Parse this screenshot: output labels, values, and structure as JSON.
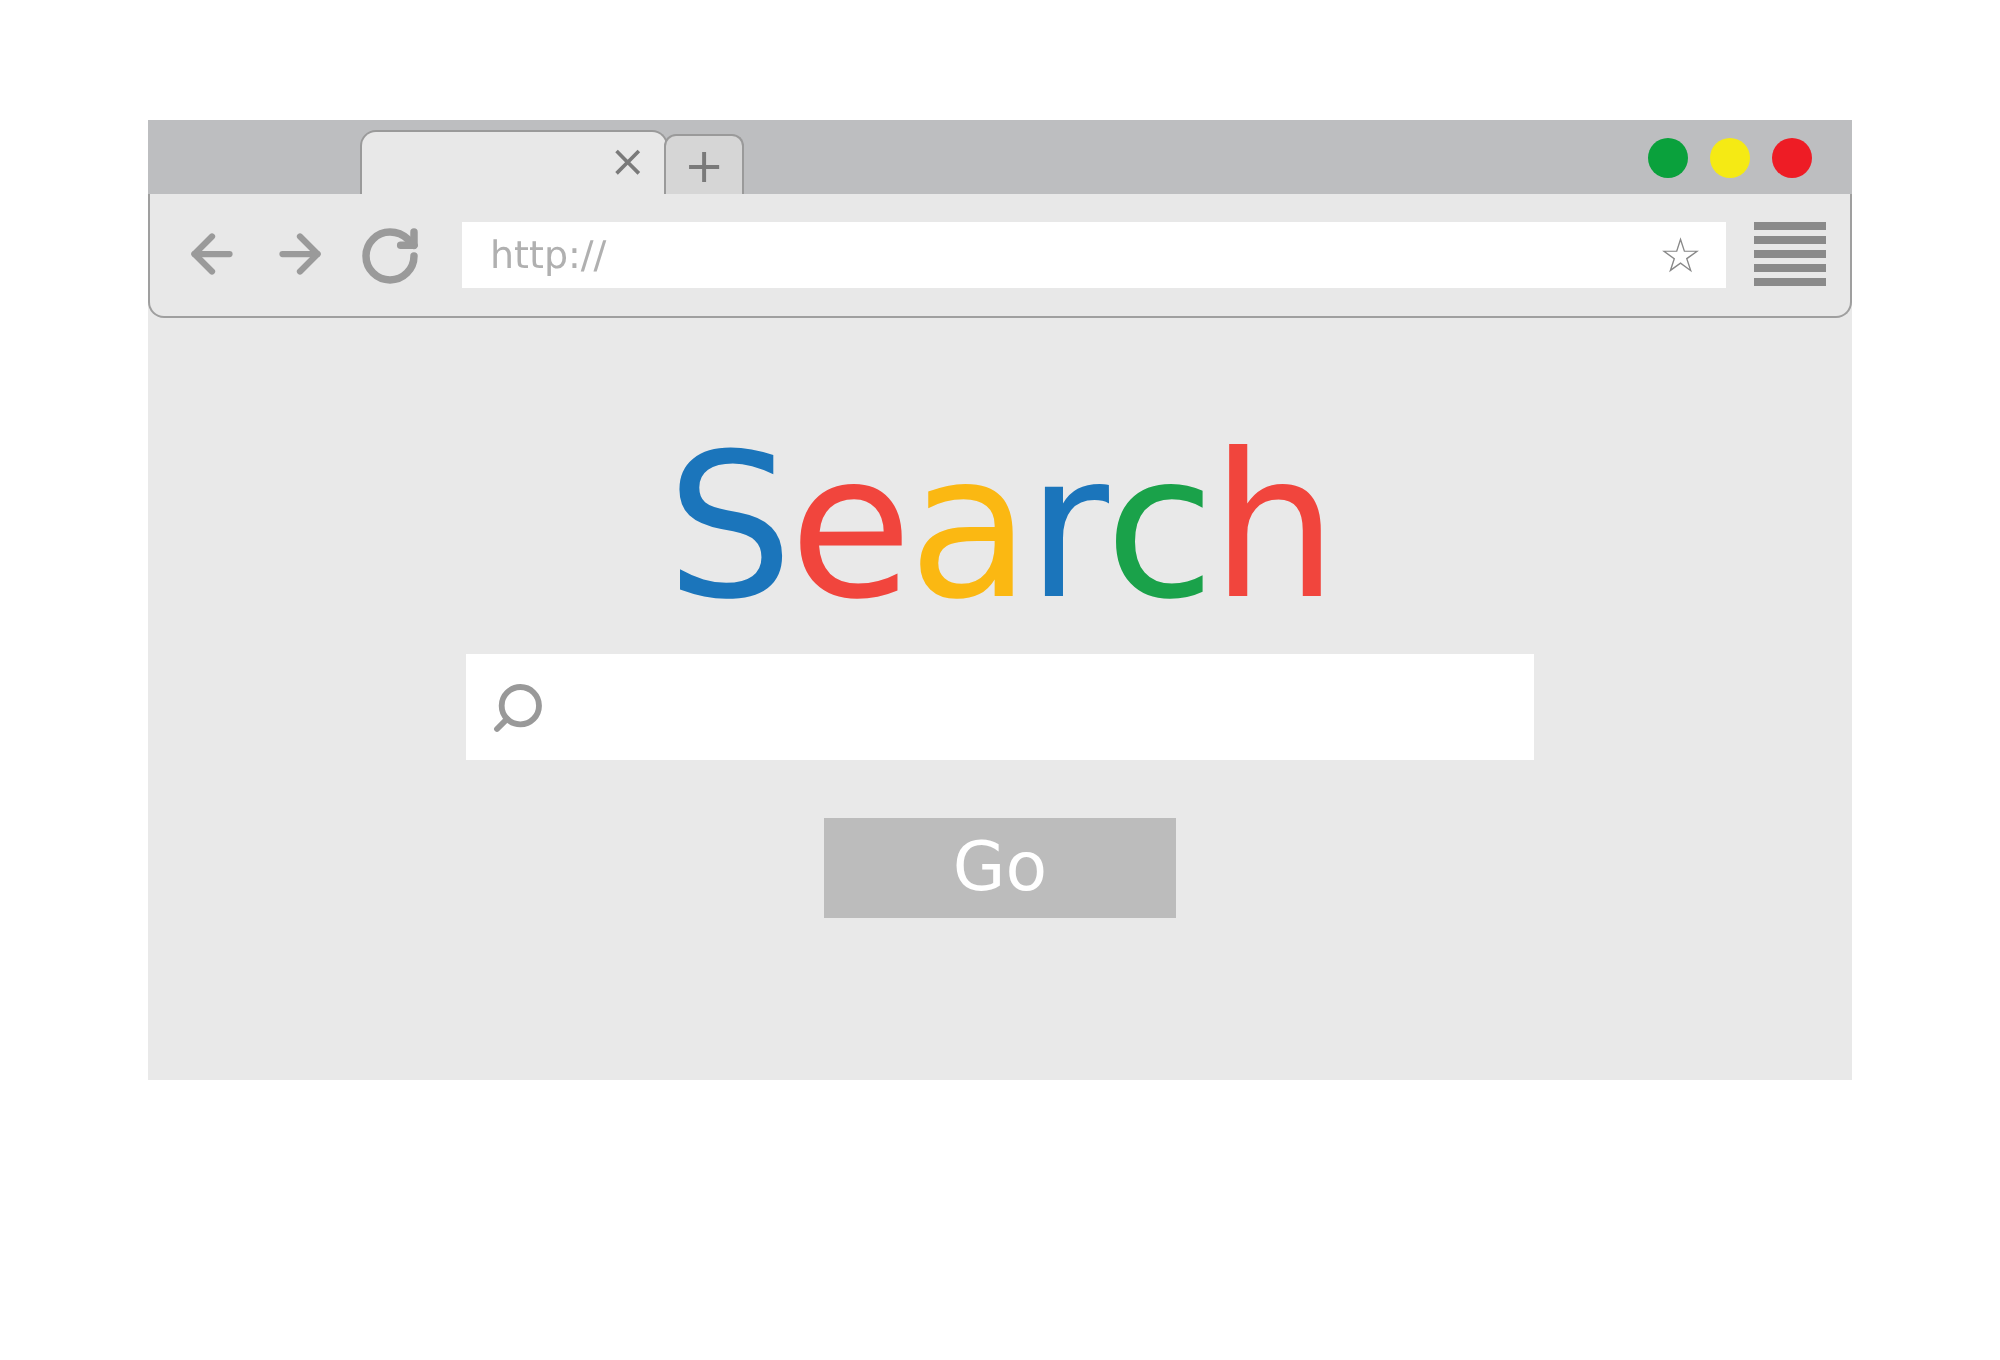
{
  "tabs": [
    {
      "selected": true,
      "close": "×"
    }
  ],
  "new_tab": "+",
  "window_controls": [
    {
      "color": "#0aa13c"
    },
    {
      "color": "#f5ea14"
    },
    {
      "color": "#ee1c25"
    }
  ],
  "address_bar": {
    "placeholder": "http://",
    "bookmark": "☆"
  },
  "logo": [
    {
      "char": "S",
      "color": "#1b75bb"
    },
    {
      "char": "e",
      "color": "#f1453d"
    },
    {
      "char": "a",
      "color": "#fbb812"
    },
    {
      "char": "r",
      "color": "#1b75bb"
    },
    {
      "char": "c",
      "color": "#1aa24a"
    },
    {
      "char": "h",
      "color": "#f1453d"
    }
  ],
  "go_button": "Go"
}
